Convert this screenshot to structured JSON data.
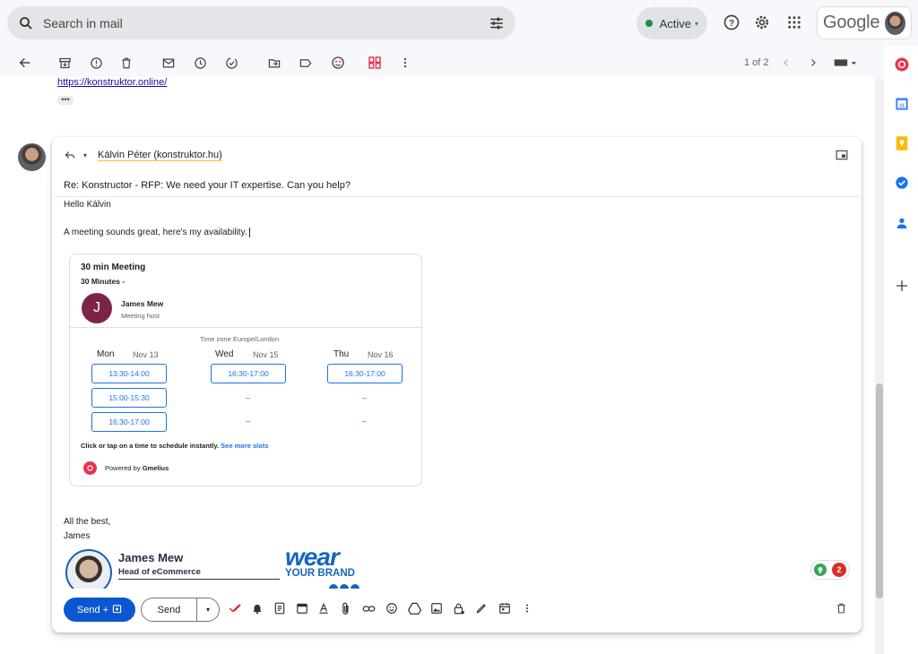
{
  "search": {
    "placeholder": "Search in mail"
  },
  "status": {
    "label": "Active"
  },
  "brand": {
    "google_label": "Google"
  },
  "pager": {
    "label": "1 of 2"
  },
  "thread": {
    "prev_link": "https://konstruktor.online/",
    "more_label": "•••"
  },
  "compose": {
    "to": "Kálvin Péter (konstruktor.hu)",
    "subject": "Re: Konstructor - RFP: We need your IT expertise. Can you help?",
    "greeting": "Hello Kálvin",
    "line1": "A meeting sounds great, here's my availability.",
    "closing": "All the best,",
    "sender": "James"
  },
  "meeting": {
    "title": "30 min Meeting",
    "duration": "30 Minutes -",
    "host_initial": "J",
    "host_name": "James Mew",
    "host_role": "Meeting host",
    "timezone": "Time zone Europe/London",
    "days": [
      {
        "name": "Mon",
        "date": "Nov 13",
        "slots": [
          "13:30-14:00",
          "15:00-15:30",
          "16:30-17:00"
        ]
      },
      {
        "name": "Wed",
        "date": "Nov 15",
        "slots": [
          "16:30-17:00",
          "–",
          "–"
        ]
      },
      {
        "name": "Thu",
        "date": "Nov 16",
        "slots": [
          "16:30-17:00",
          "–",
          "–"
        ]
      }
    ],
    "instructions": "Click or tap on a time to schedule instantly.",
    "see_more": "See more slots",
    "powered_prefix": "Powered by",
    "powered_brand": "Gmelius"
  },
  "signature": {
    "name": "James Mew",
    "title": "Head of eCommerce",
    "logo_line1": "wear",
    "logo_line2": "YOUR BRAND"
  },
  "bottom": {
    "send_plus": "Send +",
    "send": "Send",
    "badge_count": "2"
  }
}
